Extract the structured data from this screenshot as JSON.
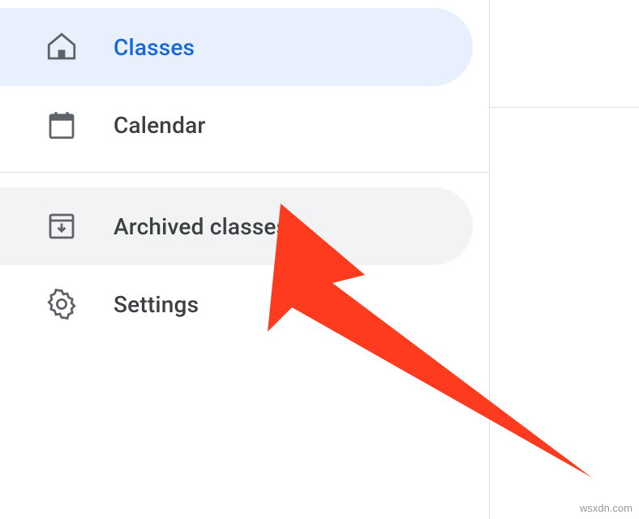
{
  "sidebar": {
    "items": [
      {
        "label": "Classes"
      },
      {
        "label": "Calendar"
      },
      {
        "label": "Archived classes"
      },
      {
        "label": "Settings"
      }
    ]
  },
  "watermark": "wsxdn.com",
  "colors": {
    "active_bg": "#e8f0fe",
    "hover_bg": "#f1f3f4",
    "text": "#3c4043",
    "active_text": "#1967d2",
    "arrow": "#ff3b1f"
  }
}
